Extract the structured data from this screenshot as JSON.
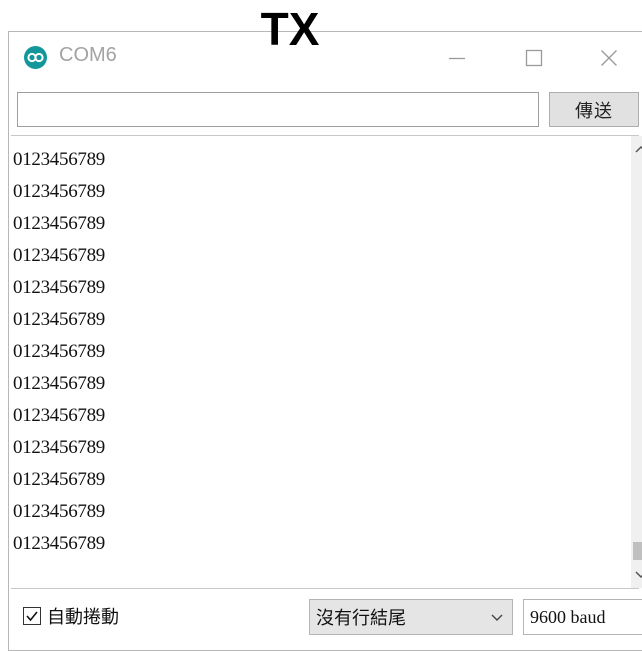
{
  "overlay_label": "TX",
  "window": {
    "title": "COM6",
    "app_icon": "arduino-infinity-icon"
  },
  "controls": {
    "minimize_icon": "minimize-icon",
    "maximize_icon": "maximize-icon",
    "close_icon": "close-icon"
  },
  "send_bar": {
    "input_value": "",
    "send_label": "傳送"
  },
  "output": {
    "lines": [
      "0123456789",
      "0123456789",
      "0123456789",
      "0123456789",
      "0123456789",
      "0123456789",
      "0123456789",
      "0123456789",
      "0123456789",
      "0123456789",
      "0123456789",
      "0123456789",
      "0123456789"
    ]
  },
  "bottom_bar": {
    "autoscroll_label": "自動捲動",
    "autoscroll_checked": true,
    "line_ending": "沒有行結尾",
    "baud_rate": "9600 baud"
  },
  "colors": {
    "app_icon": "#13979b",
    "title_text": "#a3a3a3",
    "button_face": "#e1e1e1"
  }
}
